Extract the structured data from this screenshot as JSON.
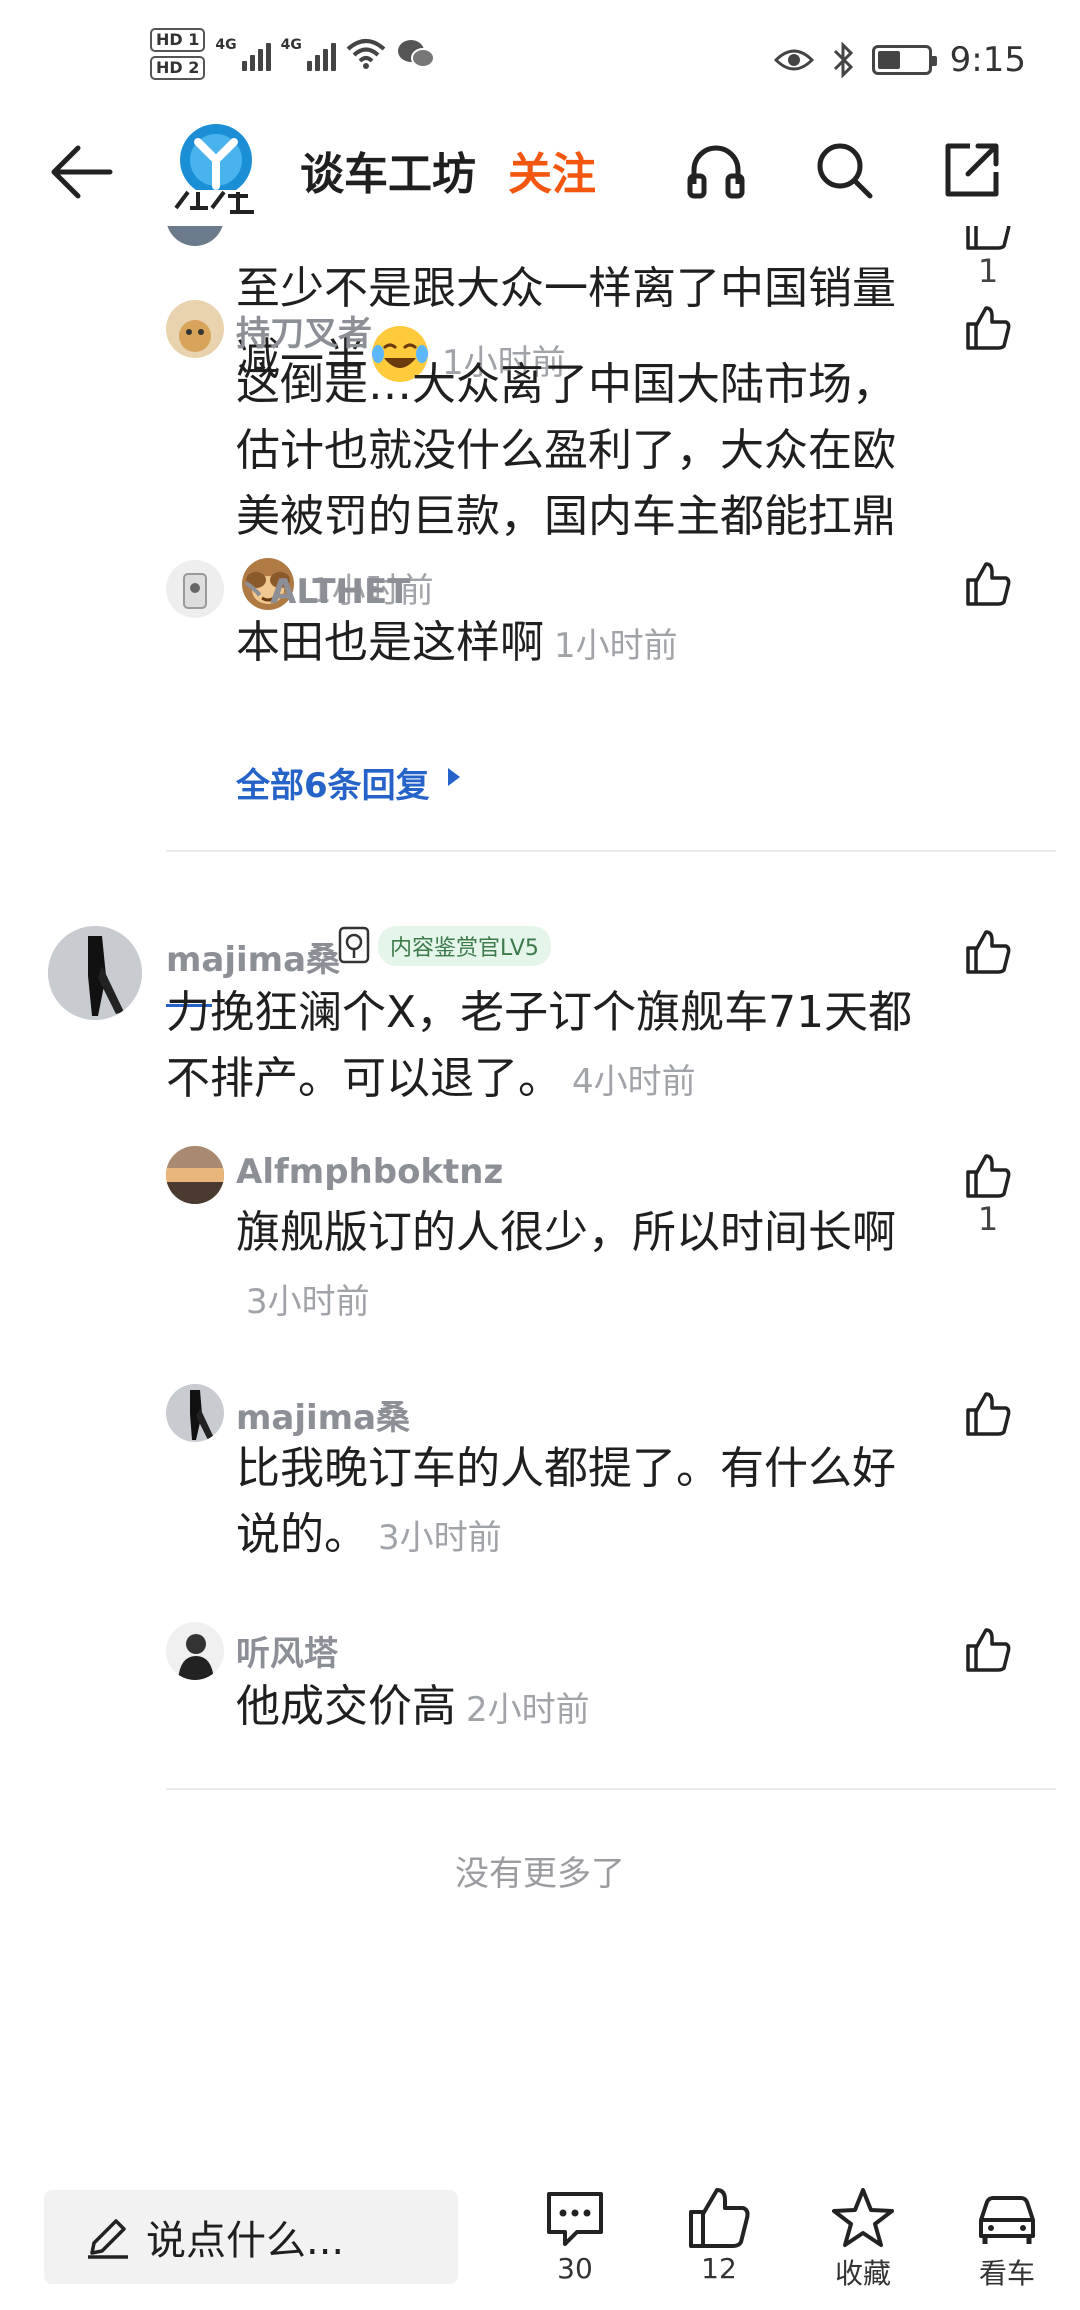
{
  "status_bar": {
    "hd1": "HD 1",
    "hd2": "HD 2",
    "net1": "4G",
    "net2": "4G",
    "time": "9:15"
  },
  "header": {
    "title": "谈车工坊",
    "follow_label": "关注",
    "icons": [
      "back-arrow-icon",
      "headphones-icon",
      "search-icon",
      "share-icon"
    ]
  },
  "replies_group1": [
    {
      "text": "至少不是跟大众一样离了中国销量减一半",
      "time": "1小时前",
      "likes": "1",
      "emoji": "rolling-laugh"
    },
    {
      "user": "持刀叉者",
      "text": "这倒是…大众离了中国大陆市场，估计也就没什么盈利了，大众在欧美被罚的巨款，国内车主都能扛鼎",
      "time": "1小时前",
      "emoji": "see-no-evil-monkey"
    },
    {
      "user": "丶ALTHET",
      "text": "本田也是这样啊",
      "time": "1小时前"
    }
  ],
  "more_replies": "全部6条回复",
  "main_comment": {
    "user": "majima桑",
    "badge": "内容鉴赏官LV5",
    "text": "力挽狂澜个X，老子订个旗舰车71天都不排产。可以退了。",
    "time": "4小时前"
  },
  "replies_group2": [
    {
      "user": "Alfmphboktnz",
      "text": "旗舰版订的人很少，所以时间长啊",
      "time": "3小时前",
      "likes": "1"
    },
    {
      "user": "majima桑",
      "text": "比我晚订车的人都提了。有什么好说的。",
      "time": "3小时前"
    },
    {
      "user": "听风塔",
      "text": "他成交价高",
      "time": "2小时前"
    }
  ],
  "no_more": "没有更多了",
  "bottom_bar": {
    "input_placeholder": "说点什么...",
    "comment_count": "30",
    "like_count": "12",
    "favorite_label": "收藏",
    "car_label": "看车"
  },
  "colors": {
    "follow": "#f3560f",
    "link": "#2563c9",
    "username": "#8c8f96",
    "time": "#a0a3a8"
  }
}
